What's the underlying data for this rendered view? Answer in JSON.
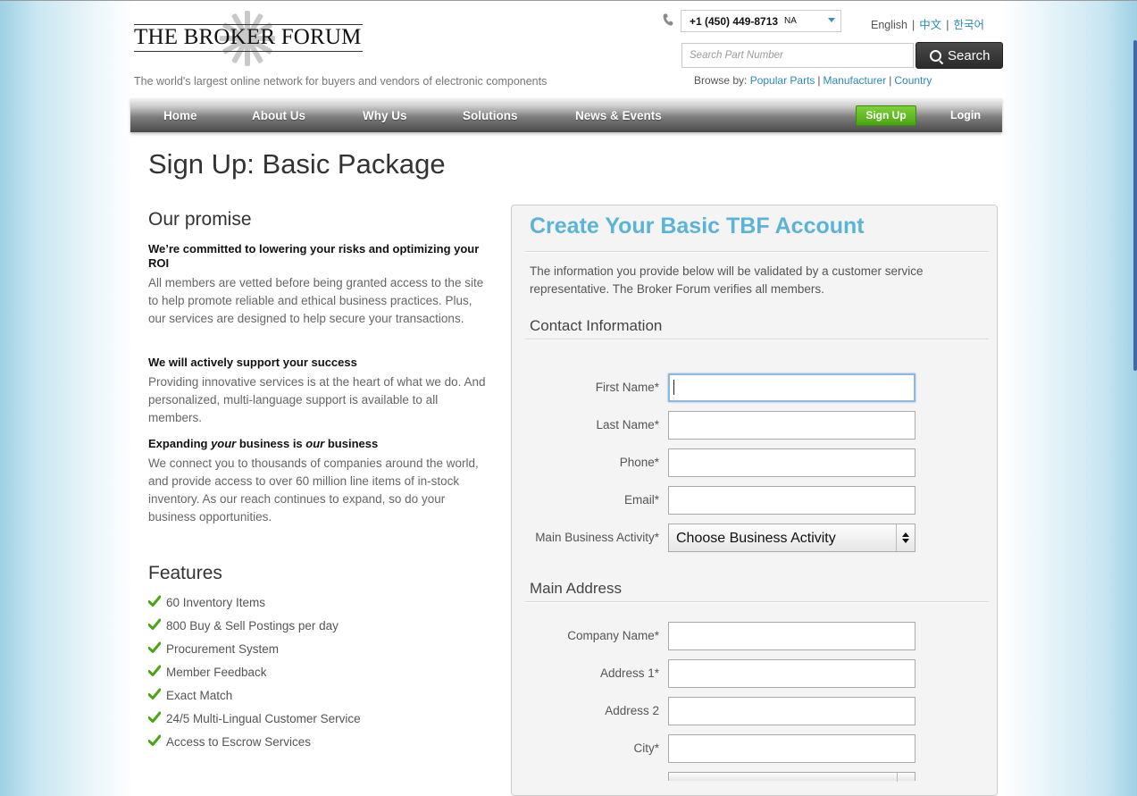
{
  "header": {
    "logo_text": "THE BROKER FORUM",
    "tagline": "The world's largest online network for buyers and vendors of electronic components",
    "phone": {
      "number": "+1 (450) 449-8713",
      "region": "NA"
    },
    "languages": [
      {
        "label": "English",
        "current": true
      },
      {
        "label": "中文",
        "current": false
      },
      {
        "label": "한국어",
        "current": false
      }
    ],
    "search": {
      "placeholder": "Search Part Number",
      "button_label": "Search"
    },
    "browse": {
      "prefix": "Browse by:",
      "links": [
        "Popular Parts",
        "Manufacturer",
        "Country"
      ]
    }
  },
  "nav": {
    "items": [
      "Home",
      "About Us",
      "Why Us",
      "Solutions",
      "News & Events"
    ],
    "signup_label": "Sign Up",
    "login_label": "Login"
  },
  "page_title": "Sign Up: Basic Package",
  "promise": {
    "heading": "Our promise",
    "blocks": [
      {
        "title": "We’re committed to lowering your risks and optimizing your ROI",
        "body": "All members are vetted before being granted access to the site to help promote reliable and ethical business practices. Plus, our services are designed to help secure your transactions."
      },
      {
        "title": "We will actively support your success",
        "body": "Providing innovative services is at the heart of what we do. And personalized, multi-language support is available to all members."
      },
      {
        "title_parts": [
          "Expanding ",
          "your",
          " business is ",
          "our",
          " business"
        ],
        "body": "We connect you to thousands of companies around the world, and provide access to over 60 million line items of in-stock inventory. As our reach continues to expand, so do your business opportunities."
      }
    ]
  },
  "features": {
    "heading": "Features",
    "items": [
      "60 Inventory Items",
      "800 Buy & Sell Postings per day",
      "Procurement System",
      "Member Feedback",
      "Exact Match",
      "24/5 Multi-Lingual Customer Service",
      "Access to Escrow Services"
    ]
  },
  "form": {
    "title": "Create Your Basic TBF Account",
    "intro": "The information you provide below will be validated by a customer service representative. The Broker Forum verifies all members.",
    "contact_heading": "Contact Information",
    "contact_fields": [
      {
        "label": "First Name*",
        "value": ""
      },
      {
        "label": "Last Name*",
        "value": ""
      },
      {
        "label": "Phone*",
        "value": ""
      },
      {
        "label": "Email*",
        "value": ""
      }
    ],
    "business_activity": {
      "label": "Main Business Activity*",
      "selected": "Choose Business Activity"
    },
    "address_heading": "Main Address",
    "address_fields": [
      {
        "label": "Company Name*",
        "value": ""
      },
      {
        "label": "Address 1*",
        "value": ""
      },
      {
        "label": "Address 2",
        "value": ""
      },
      {
        "label": "City*",
        "value": ""
      }
    ]
  },
  "colors": {
    "accent_blue": "#5bb4d6",
    "link_blue": "#2a8ab5",
    "signup_green": "#5cb81e",
    "check_green": "#4aa512"
  }
}
